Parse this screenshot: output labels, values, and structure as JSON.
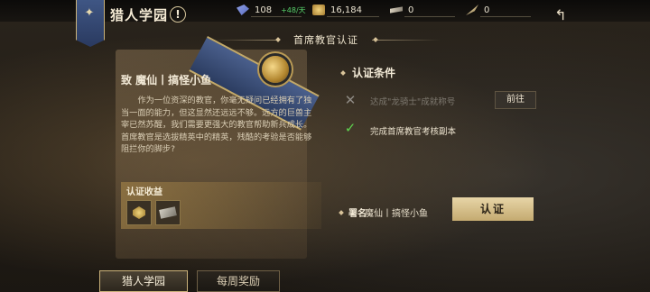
{
  "topbar": {
    "title": "猎人学园",
    "info_icon_glyph": "!",
    "resources": {
      "energy": {
        "value": "108",
        "rate": "+48/天",
        "icon": "energy-crystal-icon"
      },
      "coin": {
        "value": "16,184",
        "icon": "coin-icon"
      },
      "key": {
        "value": "0",
        "icon": "key-item-icon"
      },
      "quill": {
        "value": "0",
        "icon": "quill-item-icon"
      }
    },
    "back_icon": "back-arrow-icon"
  },
  "header": {
    "title": "首席教官认证"
  },
  "letter": {
    "to": "致 魔仙丨搞怪小鱼",
    "paragraph_1": "作为一位资深的教官，你毫无疑问已经拥有了独当一面的能力，但这显然还远远不够。远方的巨兽主宰已然苏醒，我们需要更强大的教官帮助新兵成长。",
    "paragraph_2": "首席教官是选拔精英中的精英，残酷的考验是否能够阻拦你的脚步?"
  },
  "rewards": {
    "title": "认证收益",
    "items": [
      {
        "icon": "gold-medal-reward-icon"
      },
      {
        "icon": "silver-ticket-reward-icon"
      }
    ]
  },
  "conditions": {
    "title": "认证条件",
    "items": [
      {
        "text": "达成\"龙骑士\"成就称号",
        "status": "incomplete",
        "action": "前往"
      },
      {
        "text": "完成首席教官考核副本",
        "status": "complete"
      }
    ]
  },
  "signature": {
    "label": "署名",
    "name": "魔仙丨搞怪小鱼"
  },
  "certify_button": "认证",
  "bottom_tabs": [
    {
      "label": "猎人学园",
      "selected": true
    },
    {
      "label": "每周奖励",
      "selected": false
    }
  ],
  "colors": {
    "accent_gold": "#e0cc9c",
    "complete_green": "#5fd44f",
    "positive_rate": "#56d06a"
  }
}
